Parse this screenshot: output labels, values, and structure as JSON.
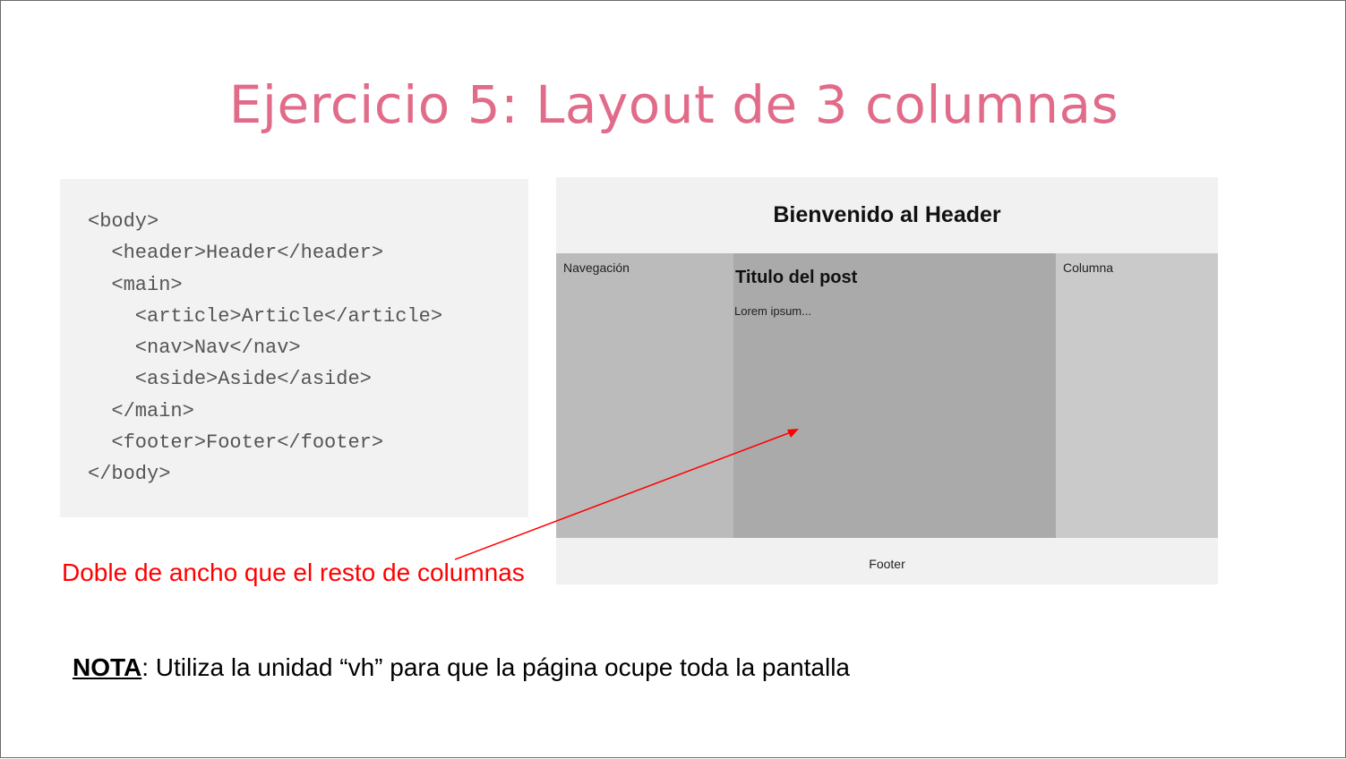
{
  "title": "Ejercicio 5: Layout de 3 columnas",
  "code_lines": [
    "<body>",
    "  <header>Header</header>",
    "  <main>",
    "    <article>Article</article>",
    "    <nav>Nav</nav>",
    "    <aside>Aside</aside>",
    "  </main>",
    "  <footer>Footer</footer>",
    "</body>"
  ],
  "preview": {
    "header": "Bienvenido al Header",
    "nav": "Navegación",
    "post_title": "Titulo del post",
    "post_body": "Lorem ipsum...",
    "aside": "Columna",
    "footer": "Footer"
  },
  "annotation": "Doble de ancho que el resto de columnas",
  "note": {
    "label": "NOTA",
    "text": ": Utiliza la unidad “vh” para que la página ocupe toda la pantalla"
  },
  "colors": {
    "title": "#e06c8a",
    "annotation": "#ff0000"
  }
}
